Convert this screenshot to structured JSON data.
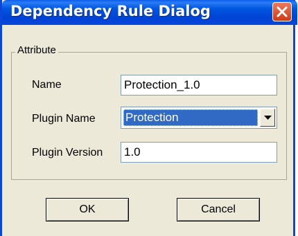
{
  "window": {
    "title": "Dependency Rule Dialog"
  },
  "group": {
    "label": "Attribute"
  },
  "fields": {
    "name": {
      "label": "Name",
      "value": "Protection_1.0"
    },
    "plugin_name": {
      "label": "Plugin Name",
      "value": "Protection"
    },
    "plugin_version": {
      "label": "Plugin Version",
      "value": "1.0"
    }
  },
  "buttons": {
    "ok": "OK",
    "cancel": "Cancel"
  },
  "icons": {
    "close": "close-icon",
    "dropdown": "chevron-down-icon"
  },
  "colors": {
    "titlebar": "#0a46d8",
    "selection": "#316ac5",
    "close": "#cf3a15",
    "dialog_bg": "#ece9d8"
  }
}
